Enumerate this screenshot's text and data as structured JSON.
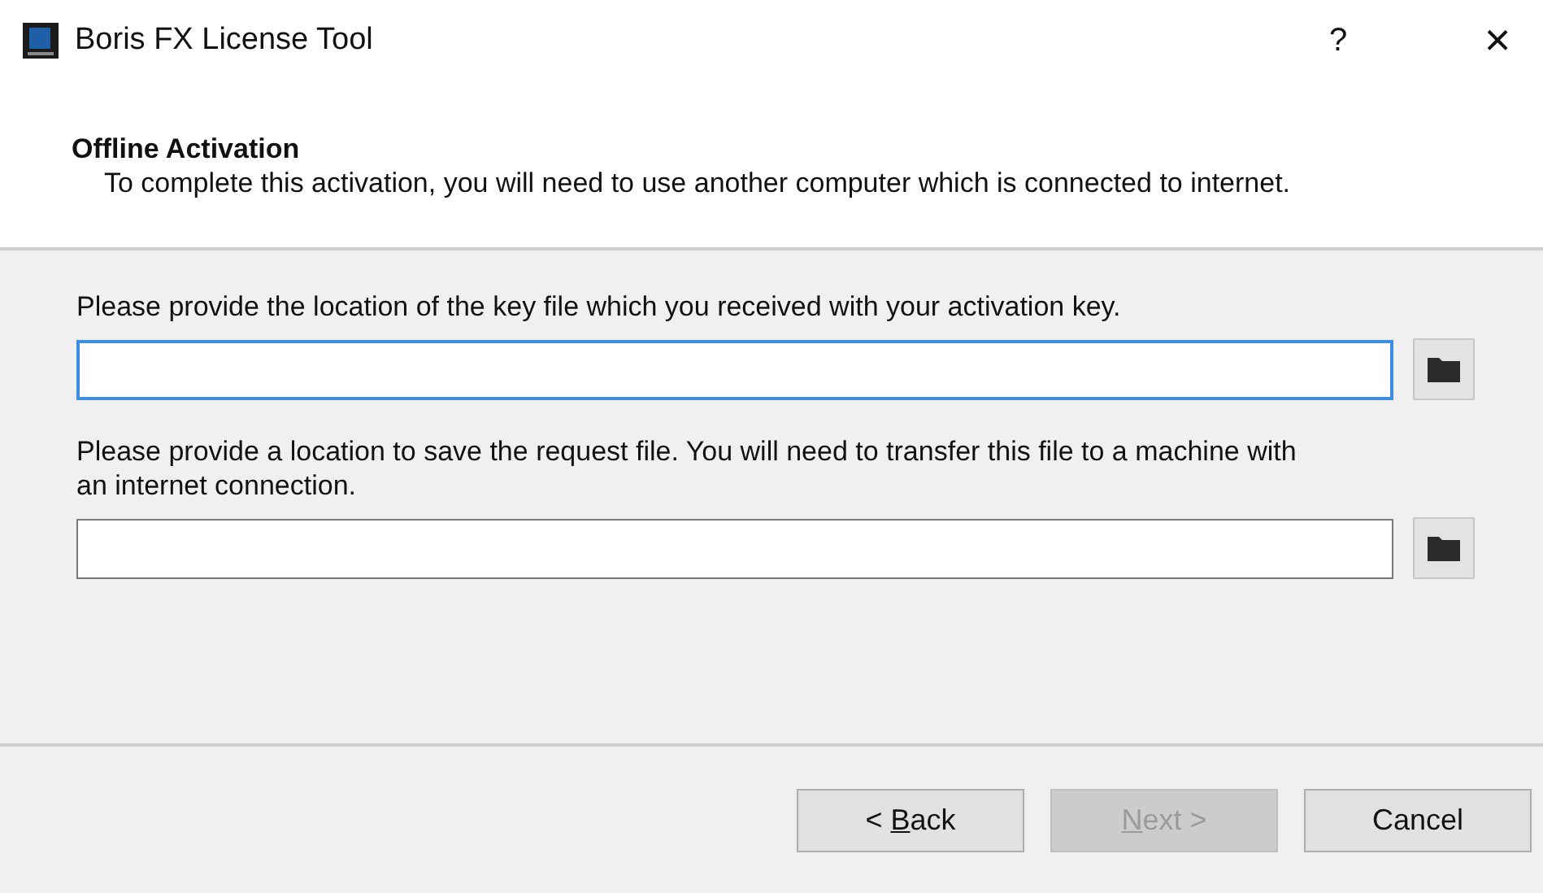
{
  "window": {
    "title": "Boris FX License Tool",
    "help": "?",
    "close": "×"
  },
  "header": {
    "title": "Offline Activation",
    "subtitle": "To complete this activation, you will need to use another computer which is connected to internet."
  },
  "fields": [
    {
      "label": "Please provide the location of the key file which you received with your activation key.",
      "focused": true
    },
    {
      "label": "Please provide a location to save the request file. You will need to transfer this file to a machine with an internet connection.",
      "focused": false
    }
  ],
  "buttons": [
    {
      "before": "< ",
      "access_key": "B",
      "after": "ack",
      "disabled": false
    },
    {
      "access_key": "N",
      "after": "ext >",
      "disabled": true
    },
    {
      "after": "Cancel",
      "disabled": false
    }
  ]
}
